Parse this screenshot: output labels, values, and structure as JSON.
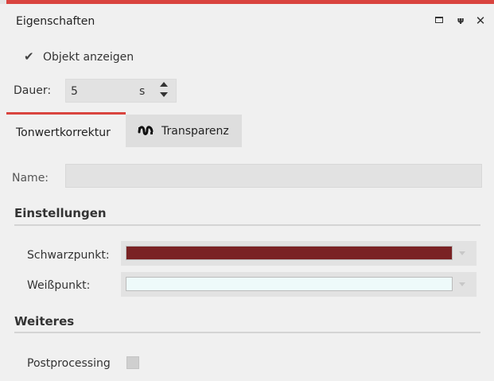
{
  "window": {
    "title": "Eigenschaften",
    "accent_color": "#d9443f",
    "icons": [
      "maximize-icon",
      "pin-icon",
      "close-icon"
    ]
  },
  "show_object": {
    "label": "Objekt anzeigen",
    "checked": true
  },
  "duration": {
    "label": "Dauer:",
    "value": "5",
    "unit": "s"
  },
  "tabs": [
    {
      "label": "Tonwertkorrektur",
      "active": true
    },
    {
      "label": "Transparenz",
      "active": false,
      "icon": "transparency-wave-icon"
    }
  ],
  "name_field": {
    "label": "Name:",
    "value": ""
  },
  "sections": {
    "settings": {
      "title": "Einstellungen",
      "black_point": {
        "label": "Schwarzpunkt:",
        "color": "#7a2224"
      },
      "white_point": {
        "label": "Weißpunkt:",
        "color": "#eefafa"
      }
    },
    "more": {
      "title": "Weiteres",
      "postprocessing": {
        "label": "Postprocessing",
        "checked": false
      }
    }
  }
}
